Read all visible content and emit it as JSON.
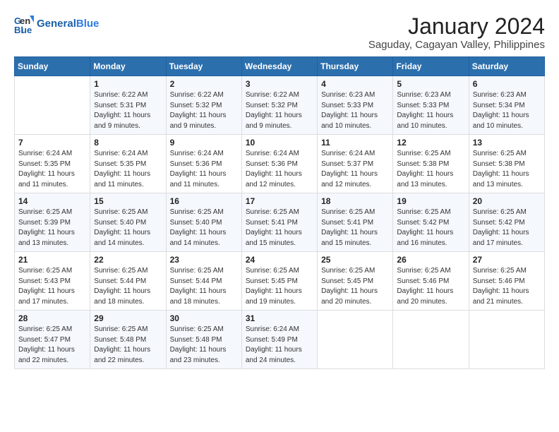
{
  "logo": {
    "line1": "General",
    "line2": "Blue"
  },
  "title": "January 2024",
  "subtitle": "Saguday, Cagayan Valley, Philippines",
  "days_header": [
    "Sunday",
    "Monday",
    "Tuesday",
    "Wednesday",
    "Thursday",
    "Friday",
    "Saturday"
  ],
  "weeks": [
    [
      {
        "day": "",
        "info": ""
      },
      {
        "day": "1",
        "info": "Sunrise: 6:22 AM\nSunset: 5:31 PM\nDaylight: 11 hours\nand 9 minutes."
      },
      {
        "day": "2",
        "info": "Sunrise: 6:22 AM\nSunset: 5:32 PM\nDaylight: 11 hours\nand 9 minutes."
      },
      {
        "day": "3",
        "info": "Sunrise: 6:22 AM\nSunset: 5:32 PM\nDaylight: 11 hours\nand 9 minutes."
      },
      {
        "day": "4",
        "info": "Sunrise: 6:23 AM\nSunset: 5:33 PM\nDaylight: 11 hours\nand 10 minutes."
      },
      {
        "day": "5",
        "info": "Sunrise: 6:23 AM\nSunset: 5:33 PM\nDaylight: 11 hours\nand 10 minutes."
      },
      {
        "day": "6",
        "info": "Sunrise: 6:23 AM\nSunset: 5:34 PM\nDaylight: 11 hours\nand 10 minutes."
      }
    ],
    [
      {
        "day": "7",
        "info": "Sunrise: 6:24 AM\nSunset: 5:35 PM\nDaylight: 11 hours\nand 11 minutes."
      },
      {
        "day": "8",
        "info": "Sunrise: 6:24 AM\nSunset: 5:35 PM\nDaylight: 11 hours\nand 11 minutes."
      },
      {
        "day": "9",
        "info": "Sunrise: 6:24 AM\nSunset: 5:36 PM\nDaylight: 11 hours\nand 11 minutes."
      },
      {
        "day": "10",
        "info": "Sunrise: 6:24 AM\nSunset: 5:36 PM\nDaylight: 11 hours\nand 12 minutes."
      },
      {
        "day": "11",
        "info": "Sunrise: 6:24 AM\nSunset: 5:37 PM\nDaylight: 11 hours\nand 12 minutes."
      },
      {
        "day": "12",
        "info": "Sunrise: 6:25 AM\nSunset: 5:38 PM\nDaylight: 11 hours\nand 13 minutes."
      },
      {
        "day": "13",
        "info": "Sunrise: 6:25 AM\nSunset: 5:38 PM\nDaylight: 11 hours\nand 13 minutes."
      }
    ],
    [
      {
        "day": "14",
        "info": "Sunrise: 6:25 AM\nSunset: 5:39 PM\nDaylight: 11 hours\nand 13 minutes."
      },
      {
        "day": "15",
        "info": "Sunrise: 6:25 AM\nSunset: 5:40 PM\nDaylight: 11 hours\nand 14 minutes."
      },
      {
        "day": "16",
        "info": "Sunrise: 6:25 AM\nSunset: 5:40 PM\nDaylight: 11 hours\nand 14 minutes."
      },
      {
        "day": "17",
        "info": "Sunrise: 6:25 AM\nSunset: 5:41 PM\nDaylight: 11 hours\nand 15 minutes."
      },
      {
        "day": "18",
        "info": "Sunrise: 6:25 AM\nSunset: 5:41 PM\nDaylight: 11 hours\nand 15 minutes."
      },
      {
        "day": "19",
        "info": "Sunrise: 6:25 AM\nSunset: 5:42 PM\nDaylight: 11 hours\nand 16 minutes."
      },
      {
        "day": "20",
        "info": "Sunrise: 6:25 AM\nSunset: 5:42 PM\nDaylight: 11 hours\nand 17 minutes."
      }
    ],
    [
      {
        "day": "21",
        "info": "Sunrise: 6:25 AM\nSunset: 5:43 PM\nDaylight: 11 hours\nand 17 minutes."
      },
      {
        "day": "22",
        "info": "Sunrise: 6:25 AM\nSunset: 5:44 PM\nDaylight: 11 hours\nand 18 minutes."
      },
      {
        "day": "23",
        "info": "Sunrise: 6:25 AM\nSunset: 5:44 PM\nDaylight: 11 hours\nand 18 minutes."
      },
      {
        "day": "24",
        "info": "Sunrise: 6:25 AM\nSunset: 5:45 PM\nDaylight: 11 hours\nand 19 minutes."
      },
      {
        "day": "25",
        "info": "Sunrise: 6:25 AM\nSunset: 5:45 PM\nDaylight: 11 hours\nand 20 minutes."
      },
      {
        "day": "26",
        "info": "Sunrise: 6:25 AM\nSunset: 5:46 PM\nDaylight: 11 hours\nand 20 minutes."
      },
      {
        "day": "27",
        "info": "Sunrise: 6:25 AM\nSunset: 5:46 PM\nDaylight: 11 hours\nand 21 minutes."
      }
    ],
    [
      {
        "day": "28",
        "info": "Sunrise: 6:25 AM\nSunset: 5:47 PM\nDaylight: 11 hours\nand 22 minutes."
      },
      {
        "day": "29",
        "info": "Sunrise: 6:25 AM\nSunset: 5:48 PM\nDaylight: 11 hours\nand 22 minutes."
      },
      {
        "day": "30",
        "info": "Sunrise: 6:25 AM\nSunset: 5:48 PM\nDaylight: 11 hours\nand 23 minutes."
      },
      {
        "day": "31",
        "info": "Sunrise: 6:24 AM\nSunset: 5:49 PM\nDaylight: 11 hours\nand 24 minutes."
      },
      {
        "day": "",
        "info": ""
      },
      {
        "day": "",
        "info": ""
      },
      {
        "day": "",
        "info": ""
      }
    ]
  ]
}
